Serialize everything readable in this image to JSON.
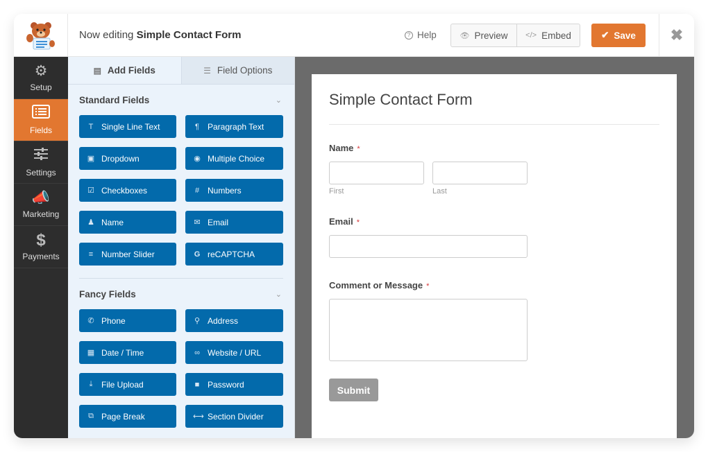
{
  "header": {
    "editing_prefix": "Now editing",
    "form_name": "Simple Contact Form",
    "help_label": "Help",
    "preview_label": "Preview",
    "embed_label": "Embed",
    "save_label": "Save",
    "accent_color": "#e27730"
  },
  "sidebar": {
    "items": [
      {
        "label": "Setup",
        "icon": "gear-icon",
        "active": false
      },
      {
        "label": "Fields",
        "icon": "list-icon",
        "active": true
      },
      {
        "label": "Settings",
        "icon": "sliders-icon",
        "active": false
      },
      {
        "label": "Marketing",
        "icon": "megaphone-icon",
        "active": false
      },
      {
        "label": "Payments",
        "icon": "dollar-icon",
        "active": false
      }
    ]
  },
  "panel": {
    "tabs": [
      {
        "label": "Add Fields",
        "active": true
      },
      {
        "label": "Field Options",
        "active": false
      }
    ],
    "sections": [
      {
        "title": "Standard Fields",
        "fields": [
          {
            "label": "Single Line Text",
            "icon": "text-cursor-icon"
          },
          {
            "label": "Paragraph Text",
            "icon": "paragraph-icon"
          },
          {
            "label": "Dropdown",
            "icon": "dropdown-icon"
          },
          {
            "label": "Multiple Choice",
            "icon": "radio-icon"
          },
          {
            "label": "Checkboxes",
            "icon": "checkbox-icon"
          },
          {
            "label": "Numbers",
            "icon": "hash-icon"
          },
          {
            "label": "Name",
            "icon": "user-icon"
          },
          {
            "label": "Email",
            "icon": "envelope-icon"
          },
          {
            "label": "Number Slider",
            "icon": "sliders-icon"
          },
          {
            "label": "reCAPTCHA",
            "icon": "google-icon"
          }
        ]
      },
      {
        "title": "Fancy Fields",
        "fields": [
          {
            "label": "Phone",
            "icon": "phone-icon"
          },
          {
            "label": "Address",
            "icon": "map-pin-icon"
          },
          {
            "label": "Date / Time",
            "icon": "calendar-icon"
          },
          {
            "label": "Website / URL",
            "icon": "link-icon"
          },
          {
            "label": "File Upload",
            "icon": "upload-icon"
          },
          {
            "label": "Password",
            "icon": "lock-icon"
          },
          {
            "label": "Page Break",
            "icon": "copy-icon"
          },
          {
            "label": "Section Divider",
            "icon": "divider-icon"
          }
        ]
      }
    ],
    "button_color": "#036aab"
  },
  "form": {
    "title": "Simple Contact Form",
    "name_label": "Name",
    "first_sublabel": "First",
    "last_sublabel": "Last",
    "email_label": "Email",
    "message_label": "Comment or Message",
    "required_mark": "*",
    "submit_label": "Submit"
  }
}
